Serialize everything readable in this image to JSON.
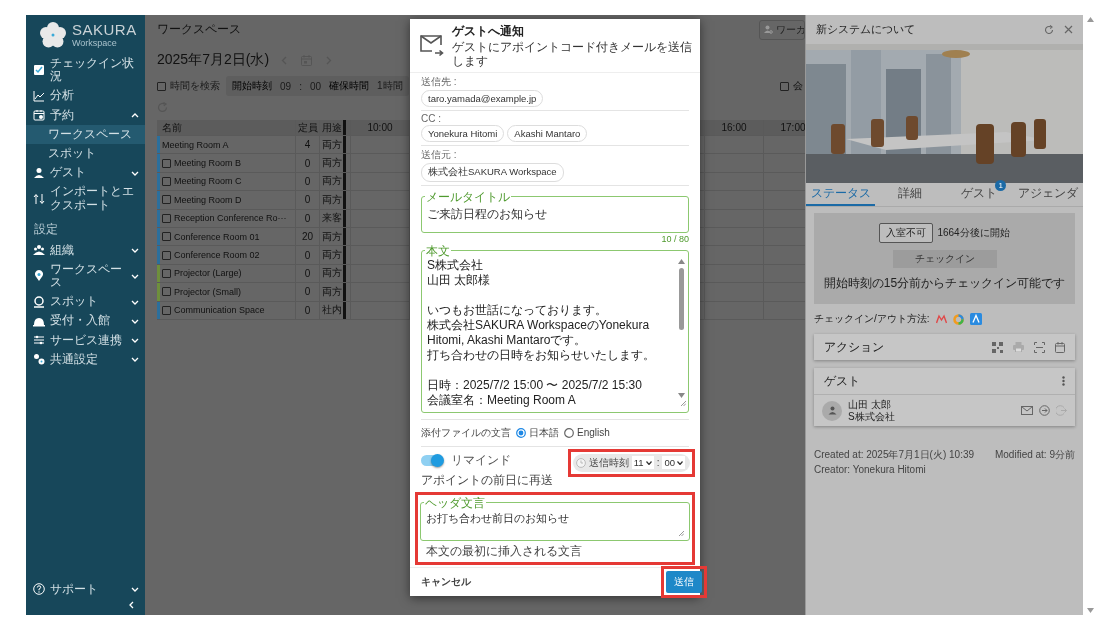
{
  "sidebar": {
    "logo": {
      "name": "SAKURA",
      "sub": "Workspace"
    },
    "items": [
      {
        "label": "チェックイン状況",
        "selected": false
      },
      {
        "label": "分析",
        "selected": false
      },
      {
        "label": "予約",
        "selected": false,
        "expanded": true,
        "children": [
          {
            "label": "ワークスペース",
            "selected": true
          },
          {
            "label": "スポット",
            "selected": false
          }
        ]
      },
      {
        "label": "ゲスト",
        "selected": false,
        "expanded": false
      },
      {
        "label": "インポートとエクスポート",
        "selected": false
      }
    ],
    "section": "設定",
    "settings_items": [
      {
        "label": "組織",
        "selected": false,
        "expanded": false
      },
      {
        "label": "ワークスペース",
        "selected": false,
        "expanded": false
      },
      {
        "label": "スポット",
        "selected": false,
        "expanded": false
      },
      {
        "label": "受付・入館",
        "selected": false,
        "expanded": false
      },
      {
        "label": "サービス連携",
        "selected": false,
        "expanded": false
      },
      {
        "label": "共通設定",
        "selected": false,
        "expanded": false
      }
    ],
    "support": {
      "label": "サポート",
      "expanded": false
    }
  },
  "main": {
    "title": "ワークスペース",
    "search_placeholder": "ワーカ",
    "date": "2025年7月2日(水)",
    "filter": {
      "checkbox_label": "時間を検索",
      "checked": false,
      "start_label": "開始時刻",
      "start_hour": "09",
      "separator": ":",
      "start_minute": "00",
      "duration_label": "確保時間",
      "duration": "1時間",
      "right_checkbox_label": "会",
      "right_checked": false
    },
    "table": {
      "columns": [
        "名前",
        "定員",
        "用途"
      ],
      "time_columns": [
        "10:00",
        "16:00",
        "17:00"
      ],
      "rows": [
        {
          "kind": "plain",
          "name": "Meeting Room A",
          "capacity": "4",
          "usage": "両方",
          "color": "#2b6f9c"
        },
        {
          "kind": "checkbox",
          "checked": false,
          "name": "Meeting Room B",
          "capacity": "0",
          "usage": "両方",
          "color": "#2b6f9c"
        },
        {
          "kind": "checkbox",
          "checked": false,
          "name": "Meeting Room C",
          "capacity": "0",
          "usage": "両方",
          "color": "#2b6f9c"
        },
        {
          "kind": "checkbox",
          "checked": false,
          "name": "Meeting Room D",
          "capacity": "0",
          "usage": "両方",
          "color": "#2b6f9c"
        },
        {
          "kind": "checkbox",
          "checked": false,
          "name": "Reception Conference Ro···",
          "capacity": "0",
          "usage": "来客",
          "color": "#2b6f9c"
        },
        {
          "kind": "checkbox",
          "checked": false,
          "name": "Conference Room 01",
          "capacity": "20",
          "usage": "両方",
          "color": "#2b6f9c"
        },
        {
          "kind": "checkbox",
          "checked": false,
          "name": "Conference Room 02",
          "capacity": "0",
          "usage": "両方",
          "color": "#2b6f9c"
        },
        {
          "kind": "checkbox",
          "checked": false,
          "name": "Projector (Large)",
          "capacity": "0",
          "usage": "両方",
          "color": "#6e8f3c"
        },
        {
          "kind": "checkbox",
          "checked": false,
          "name": "Projector (Small)",
          "capacity": "0",
          "usage": "両方",
          "color": "#6e8f3c"
        },
        {
          "kind": "checkbox",
          "checked": false,
          "name": "Communication Space",
          "capacity": "0",
          "usage": "社内",
          "color": "#2b6f9c"
        }
      ]
    }
  },
  "detail_panel": {
    "title": "新システムについて",
    "tabs": [
      {
        "label": "ステータス",
        "selected": true
      },
      {
        "label": "詳細",
        "selected": false
      },
      {
        "label": "ゲスト",
        "selected": false,
        "badge": "1"
      },
      {
        "label": "アジェンダ",
        "selected": false
      }
    ],
    "status": {
      "badge": "入室不可",
      "start": "1664分後に開始",
      "button": {
        "label": "チェックイン",
        "disabled": true
      },
      "note": "開始時刻の15分前からチェックイン可能です"
    },
    "checkin_methods": {
      "label": "チェックイン/アウト方法:"
    },
    "actions": {
      "title": "アクション"
    },
    "guests": {
      "title": "ゲスト",
      "items": [
        {
          "name": "山田 太郎",
          "company": "S株式会社"
        }
      ]
    },
    "meta": [
      "Created at: 2025年7月1日(火) 10:39",
      "Modified at: 9分前",
      "Creator: Yonekura Hitomi"
    ]
  },
  "dialog": {
    "title": "ゲストへ通知",
    "subtitle": "ゲストにアポイントコード付きメールを送信します",
    "recipients": [
      {
        "label": "送信先 :",
        "chips": [
          "taro.yamada@example.jp"
        ]
      },
      {
        "label": "CC :",
        "chips": [
          "Yonekura Hitomi",
          "Akashi Mantaro"
        ]
      },
      {
        "label": "送信元 :",
        "chips": [
          "株式会社SAKURA Workspace"
        ]
      }
    ],
    "mail_title": {
      "label": "メールタイトル",
      "value": "ご来訪日程のお知らせ",
      "counter": "10 / 80"
    },
    "body": {
      "label": "本文",
      "paragraphs": [
        [
          "S株式会社",
          "山田 太郎様"
        ],
        [
          "いつもお世話になっております。",
          "株式会社SAKURA WorkspaceのYonekura Hitomi, Akashi Mantaroです。",
          "打ち合わせの日時をお知らせいたします。"
        ],
        [
          "日時：2025/7/2 15:00 〜 2025/7/2 15:30",
          "会議室名：Meeting Room A"
        ]
      ]
    },
    "attachment_language": {
      "label": "添付ファイルの文言",
      "options": [
        {
          "label": "日本語",
          "selected": true
        },
        {
          "label": "English",
          "selected": false
        }
      ]
    },
    "remind": {
      "label": "リマインド",
      "on": true,
      "hint": "アポイントの前日に再送",
      "send_time": {
        "label": "送信時刻",
        "hour": "11",
        "separator": ":",
        "minute": "00",
        "highlighted": true
      }
    },
    "header_text": {
      "label": "ヘッダ文言",
      "value": "お打ち合わせ前日のお知らせ",
      "hint": "本文の最初に挿入される文言",
      "highlighted": true
    },
    "cancel": "キャンセル",
    "submit": {
      "label": "送信",
      "highlighted": true
    }
  }
}
